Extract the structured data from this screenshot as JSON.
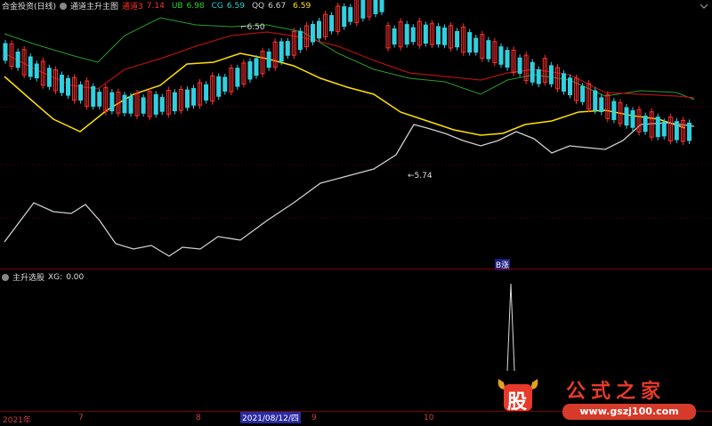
{
  "header": {
    "title": "合金投资(日线)",
    "indicator_name": "通道主升主图",
    "fields": [
      {
        "label": "通道3",
        "value": "7.14",
        "color": "#ff3030"
      },
      {
        "label": "UB",
        "value": "6.98",
        "color": "#2ad12a"
      },
      {
        "label": "CG",
        "value": "6.59",
        "color": "#2ad1d1"
      },
      {
        "label": "QQ",
        "value": "6.67",
        "color": "#d0d0d0"
      },
      {
        "label": "",
        "value": "6.59",
        "color": "#ffe000"
      }
    ]
  },
  "main_chart": {
    "high_label": "6.50",
    "low_label": "5.74",
    "signal_label": "B涨"
  },
  "sub_panel": {
    "title": "主升选股",
    "field_label": "XG:",
    "field_value": "0.00"
  },
  "axis": {
    "labels": [
      "2021年",
      "7",
      "8",
      "2021/08/12/四",
      "9",
      "10"
    ]
  },
  "logo": {
    "glyph": "股",
    "name": "公式之家",
    "url": "www.gszj100.com"
  },
  "colors": {
    "up": "#ff3030",
    "down": "#30d0e0",
    "ma": "#ffe000",
    "upper": "#b01010",
    "ub": "#2a9a2a",
    "curve": "#cfcfcf"
  }
}
